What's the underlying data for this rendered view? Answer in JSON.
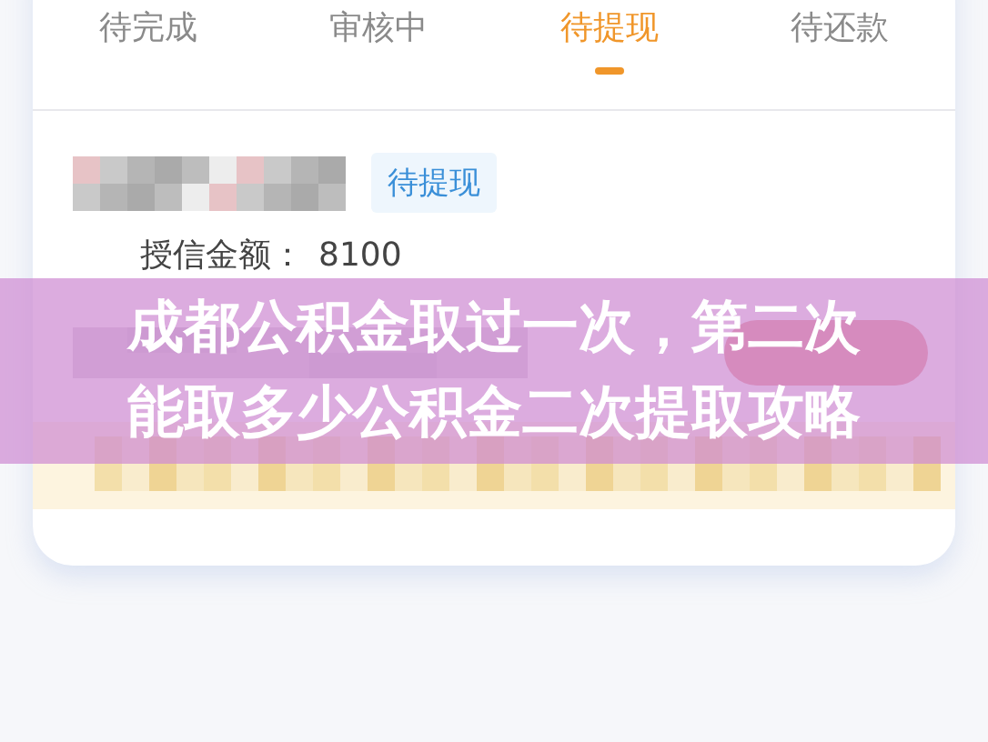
{
  "tabs": [
    {
      "label": "待完成",
      "selected": false
    },
    {
      "label": "审核中",
      "selected": false
    },
    {
      "label": "待提现",
      "selected": true
    },
    {
      "label": "待还款",
      "selected": false
    }
  ],
  "record": {
    "status_badge": "待提现",
    "credit_label": "授信金额：",
    "credit_amount": "8100"
  },
  "overlay_title": "成都公积金取过一次，第二次能取多少公积金二次提取攻略"
}
